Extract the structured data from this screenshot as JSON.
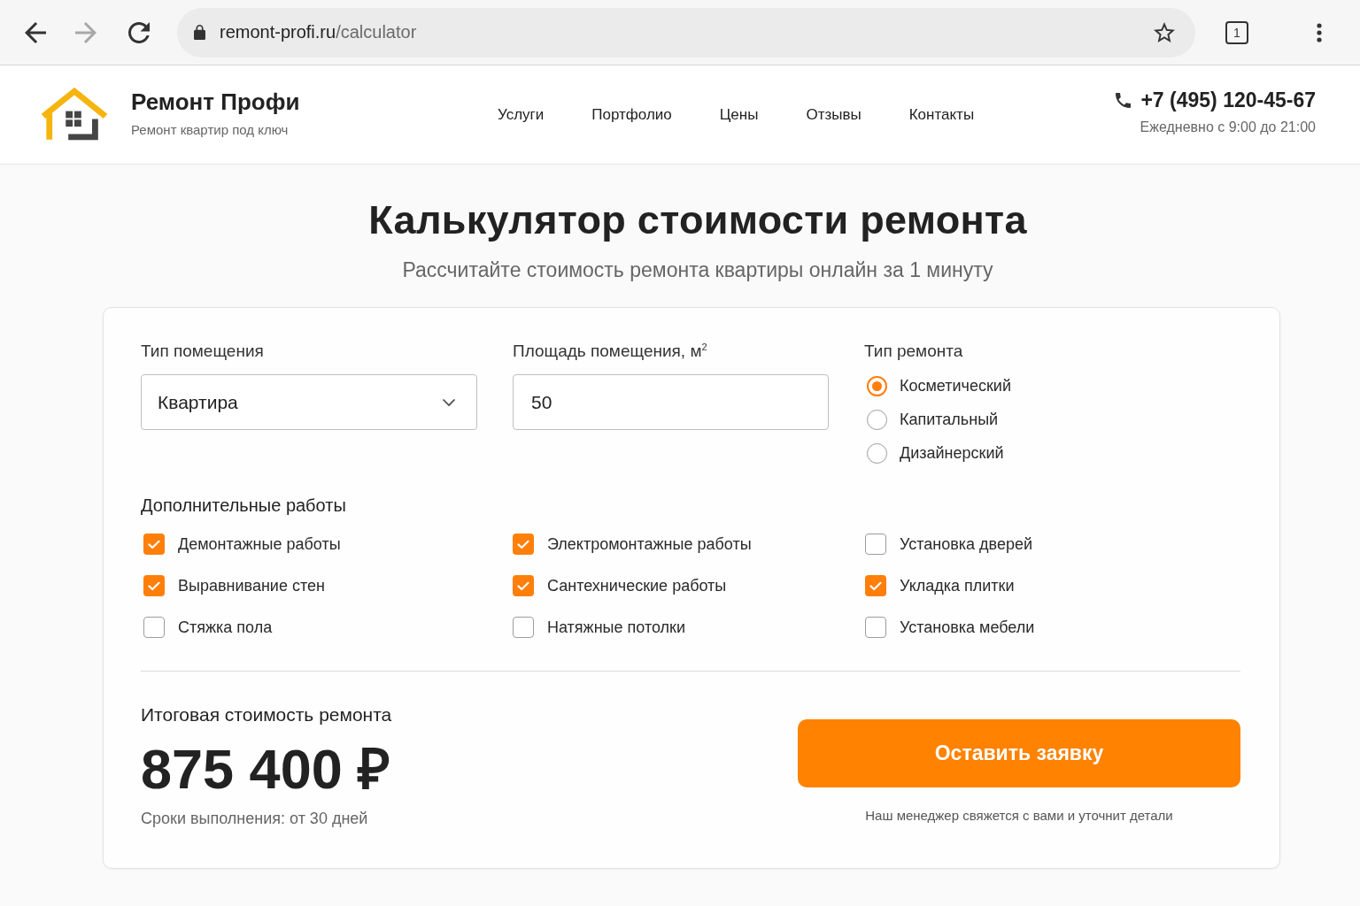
{
  "browser": {
    "url_host": "remont-profi.ru",
    "url_path": "/calculator",
    "tab_count": "1"
  },
  "header": {
    "brand": {
      "name": "Ремонт Профи",
      "tagline": "Ремонт квартир под ключ"
    },
    "nav": [
      "Услуги",
      "Портфолио",
      "Цены",
      "Отзывы",
      "Контакты"
    ],
    "phone": "+7 (495) 120-45-67",
    "hours": "Ежедневно с 9:00 до 21:00"
  },
  "page": {
    "title": "Калькулятор стоимости ремонта",
    "subtitle": "Рассчитайте стоимость ремонта квартиры онлайн за 1 минуту"
  },
  "calculator": {
    "room_type": {
      "label": "Тип помещения",
      "value": "Квартира"
    },
    "area": {
      "label": "Площадь помещения, м$^{2}$",
      "value": "50"
    },
    "repair_type": {
      "label": "Тип ремонта",
      "options": [
        {
          "label": "Косметический",
          "selected": true
        },
        {
          "label": "Капитальный",
          "selected": false
        },
        {
          "label": "Дизайнерский",
          "selected": false
        }
      ]
    },
    "extras": {
      "title": "Дополнительные работы",
      "items": [
        {
          "label": "Демонтажные работы",
          "checked": true
        },
        {
          "label": "Электромонтажные работы",
          "checked": true
        },
        {
          "label": "Установка дверей",
          "checked": false
        },
        {
          "label": "Выравнивание стен",
          "checked": true
        },
        {
          "label": "Сантехнические работы",
          "checked": true
        },
        {
          "label": "Укладка плитки",
          "checked": true
        },
        {
          "label": "Стяжка пола",
          "checked": false
        },
        {
          "label": "Натяжные потолки",
          "checked": false
        },
        {
          "label": "Установка мебели",
          "checked": false
        }
      ]
    },
    "result": {
      "label": "Итоговая стоимость ремонта",
      "total": "875 400 ₽",
      "duration": "Сроки выполнения: от 30 дней"
    },
    "submit": {
      "label": "Оставить заявку",
      "note": "Наш менеджер свяжется с вами и уточнит детали"
    }
  }
}
